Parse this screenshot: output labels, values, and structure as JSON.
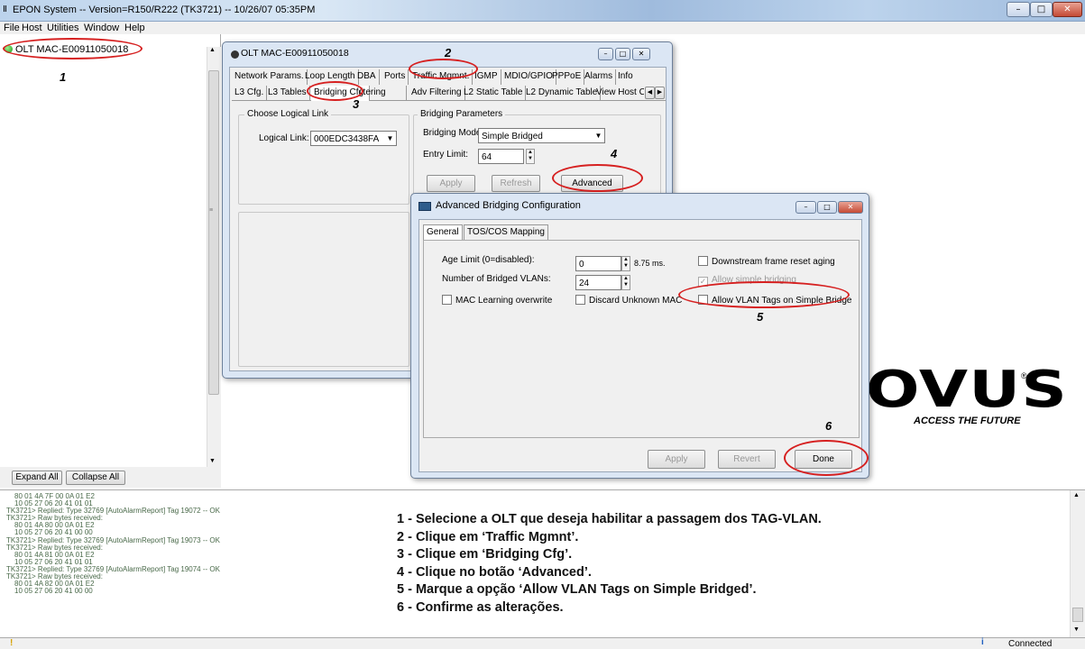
{
  "app": {
    "title": "EPON System -- Version=R150/R222 (TK3721) -- 10/26/07 05:35PM",
    "icon": "app-icon",
    "min": "–",
    "max": "□",
    "close": "✕"
  },
  "menu": [
    "File",
    "Host",
    "Utilities",
    "Window",
    "Help"
  ],
  "tree": {
    "root": "OLT MAC-E00911050018",
    "status_icon": "green-status-dot"
  },
  "left_buttons": {
    "expand": "Expand All",
    "collapse": "Collapse All"
  },
  "olt_window": {
    "title": "OLT MAC-E00911050018",
    "tabs_row1": [
      "Network Params.",
      "Loop Length",
      "DBA",
      "Ports",
      "Traffic Mgmnt.",
      "IGMP",
      "MDIO/GPIO",
      "PPPoE",
      "Alarms",
      "Info"
    ],
    "tabs_row2": [
      "L3 Cfg.",
      "L3 Tables",
      "Bridging Cfg.",
      "Filtering",
      "Adv Filtering",
      "L2 Static Table",
      "L2 Dynamic Table",
      "View Host C"
    ],
    "logical_group": "Choose Logical Link",
    "logical_label": "Logical Link:",
    "logical_value": "000EDC3438FA",
    "bridging_group": "Bridging Parameters",
    "mode_label": "Bridging Mode:",
    "mode_value": "Simple Bridged",
    "entry_label": "Entry Limit:",
    "entry_value": "64",
    "apply": "Apply",
    "refresh": "Refresh",
    "advanced": "Advanced"
  },
  "adv_window": {
    "title": "Advanced Bridging Configuration",
    "tabs": [
      "General",
      "TOS/COS Mapping"
    ],
    "age_label": "Age Limit (0=disabled):",
    "age_value": "0",
    "age_unit": "8.75 ms.",
    "vlans_label": "Number of Bridged VLANs:",
    "vlans_value": "24",
    "mac_learning": "MAC Learning overwrite",
    "discard": "Discard Unknown MAC",
    "downstream": "Downstream frame reset aging",
    "allow_simple": "Allow simple bridging",
    "allow_vlan": "Allow VLAN Tags on Simple Bridge",
    "apply": "Apply",
    "revert": "Revert",
    "done": "Done"
  },
  "annotations": [
    "1",
    "2",
    "3",
    "4",
    "5",
    "6"
  ],
  "logo": {
    "text": "OVUS",
    "reg": "®",
    "tagline": "ACCESS THE FUTURE"
  },
  "log_lines": [
    "80 01 4A 7F 00 0A 01 E2",
    "10 05 27 06 20 41 01 01",
    "TK3721> Replied: Type 32769 [AutoAlarmReport] Tag 19072 -- OK",
    "TK3721> Raw bytes received:",
    "80 01 4A 80 00 0A 01 E2",
    "10 05 27 06 20 41 00 00",
    "TK3721> Replied: Type 32769 [AutoAlarmReport] Tag 19073 -- OK",
    "TK3721> Raw bytes received:",
    "80 01 4A 81 00 0A 01 E2",
    "10 05 27 06 20 41 01 01",
    "TK3721> Replied: Type 32769 [AutoAlarmReport] Tag 19074 -- OK",
    "TK3721> Raw bytes received:",
    "80 01 4A 82 00 0A 01 E2",
    "10 05 27 06 20 41 00 00"
  ],
  "instructions": [
    "1 - Selecione a OLT que deseja habilitar a passagem dos TAG-VLAN.",
    "2 - Clique em ‘Traffic Mgmnt’.",
    "3 - Clique em ‘Bridging Cfg’.",
    "4 - Clique no botão ‘Advanced’.",
    "5 - Marque a opção ‘Allow VLAN Tags on Simple Bridged’.",
    "6 - Confirme as alterações."
  ],
  "status": {
    "text": "Connected",
    "warn_icon": "warning-icon",
    "info_icon": "info-icon"
  },
  "colors": {
    "annotation": "#d62020",
    "titlebar": "#bcd3ec",
    "connected": "#1a9a1a"
  }
}
